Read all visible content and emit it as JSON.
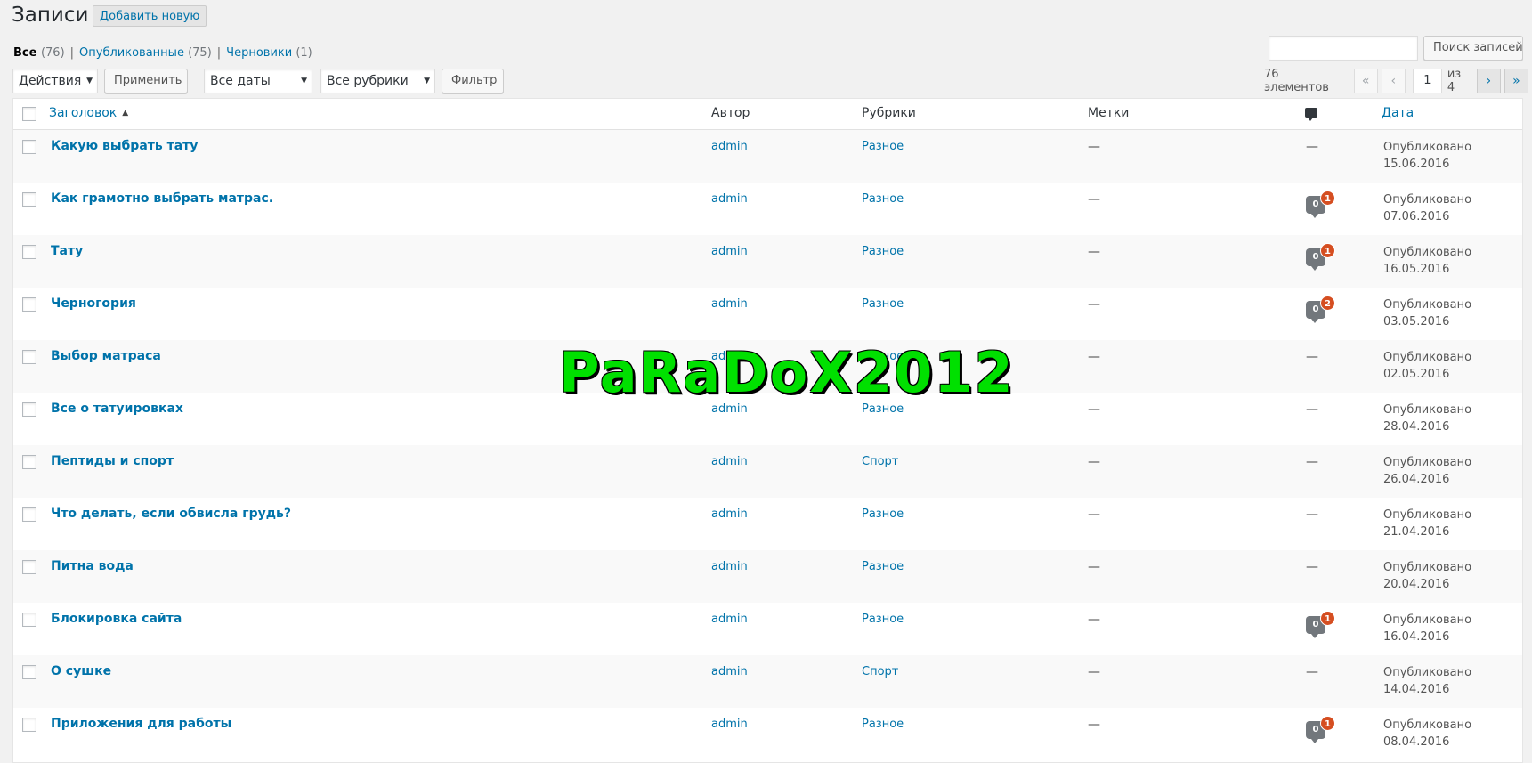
{
  "header": {
    "title": "Записи",
    "add_new_label": "Добавить новую"
  },
  "views": {
    "all_label": "Все",
    "all_count": "(76)",
    "published_label": "Опубликованные",
    "published_count": "(75)",
    "drafts_label": "Черновики",
    "drafts_count": "(1)",
    "separator": "|"
  },
  "search": {
    "value": "",
    "button_label": "Поиск записей"
  },
  "bulk": {
    "actions_selected": "Действия",
    "apply_label": "Применить",
    "dates_selected": "Все даты",
    "categories_selected": "Все рубрики",
    "filter_label": "Фильтр"
  },
  "pagination": {
    "items_text": "76 элементов",
    "first": "«",
    "prev": "‹",
    "current_page": "1",
    "of_text": "из 4",
    "next": "›",
    "last": "»"
  },
  "table": {
    "columns": {
      "title": "Заголовок",
      "author": "Автор",
      "categories": "Рубрики",
      "tags": "Метки",
      "date": "Дата"
    },
    "rows": [
      {
        "title": "Какую выбрать тату",
        "author": "admin",
        "category": "Разное",
        "tags": "—",
        "comments": "",
        "pending": "",
        "status": "Опубликовано",
        "date": "15.06.2016"
      },
      {
        "title": "Как грамотно выбрать матрас.",
        "author": "admin",
        "category": "Разное",
        "tags": "—",
        "comments": "0",
        "pending": "1",
        "status": "Опубликовано",
        "date": "07.06.2016"
      },
      {
        "title": "Тату",
        "author": "admin",
        "category": "Разное",
        "tags": "—",
        "comments": "0",
        "pending": "1",
        "status": "Опубликовано",
        "date": "16.05.2016"
      },
      {
        "title": "Черногория",
        "author": "admin",
        "category": "Разное",
        "tags": "—",
        "comments": "0",
        "pending": "2",
        "status": "Опубликовано",
        "date": "03.05.2016"
      },
      {
        "title": "Выбор матраса",
        "author": "admin",
        "category": "Разное",
        "tags": "—",
        "comments": "",
        "pending": "",
        "status": "Опубликовано",
        "date": "02.05.2016"
      },
      {
        "title": "Все о татуировках",
        "author": "admin",
        "category": "Разное",
        "tags": "—",
        "comments": "",
        "pending": "",
        "status": "Опубликовано",
        "date": "28.04.2016"
      },
      {
        "title": "Пептиды и спорт",
        "author": "admin",
        "category": "Спорт",
        "tags": "—",
        "comments": "",
        "pending": "",
        "status": "Опубликовано",
        "date": "26.04.2016"
      },
      {
        "title": "Что делать, если обвисла грудь?",
        "author": "admin",
        "category": "Разное",
        "tags": "—",
        "comments": "",
        "pending": "",
        "status": "Опубликовано",
        "date": "21.04.2016"
      },
      {
        "title": "Питна вода",
        "author": "admin",
        "category": "Разное",
        "tags": "—",
        "comments": "",
        "pending": "",
        "status": "Опубликовано",
        "date": "20.04.2016"
      },
      {
        "title": "Блокировка сайта",
        "author": "admin",
        "category": "Разное",
        "tags": "—",
        "comments": "0",
        "pending": "1",
        "status": "Опубликовано",
        "date": "16.04.2016"
      },
      {
        "title": "О сушке",
        "author": "admin",
        "category": "Спорт",
        "tags": "—",
        "comments": "",
        "pending": "",
        "status": "Опубликовано",
        "date": "14.04.2016"
      },
      {
        "title": "Приложения для работы",
        "author": "admin",
        "category": "Разное",
        "tags": "—",
        "comments": "0",
        "pending": "1",
        "status": "Опубликовано",
        "date": "08.04.2016"
      }
    ],
    "no_comments_text": "—"
  },
  "watermark": "PaRaDoX2012",
  "colors": {
    "link": "#0073aa",
    "pending_badge": "#d54e21",
    "watermark": "#00e000"
  }
}
